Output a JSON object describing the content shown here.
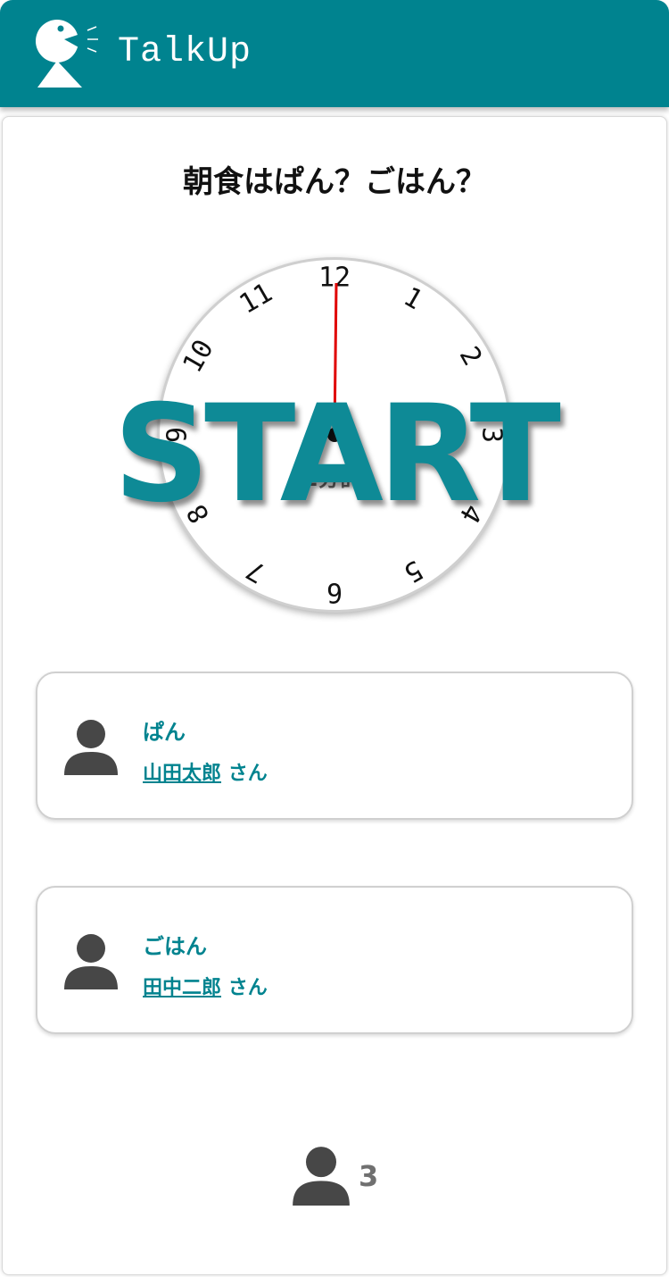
{
  "header": {
    "app_title": "TalkUp",
    "background": "#00838f"
  },
  "topic": {
    "title": "朝食はぱん？ごはん？"
  },
  "timer": {
    "start_label": "START",
    "duration_label": "2分計",
    "numbers": [
      "12",
      "1",
      "2",
      "3",
      "4",
      "5",
      "6",
      "7",
      "8",
      "9",
      "10",
      "11"
    ],
    "hand_color": "#e00000"
  },
  "speakers": [
    {
      "choice": "ぱん",
      "name": "山田太郎",
      "suffix": "さん",
      "icon": "person-icon"
    },
    {
      "choice": "ごはん",
      "name": "田中二郎",
      "suffix": "さん",
      "icon": "person-icon"
    }
  ],
  "participants": {
    "count": "3",
    "icon": "person-icon"
  },
  "colors": {
    "accent": "#00838f",
    "start_text": "#0e8a96"
  }
}
